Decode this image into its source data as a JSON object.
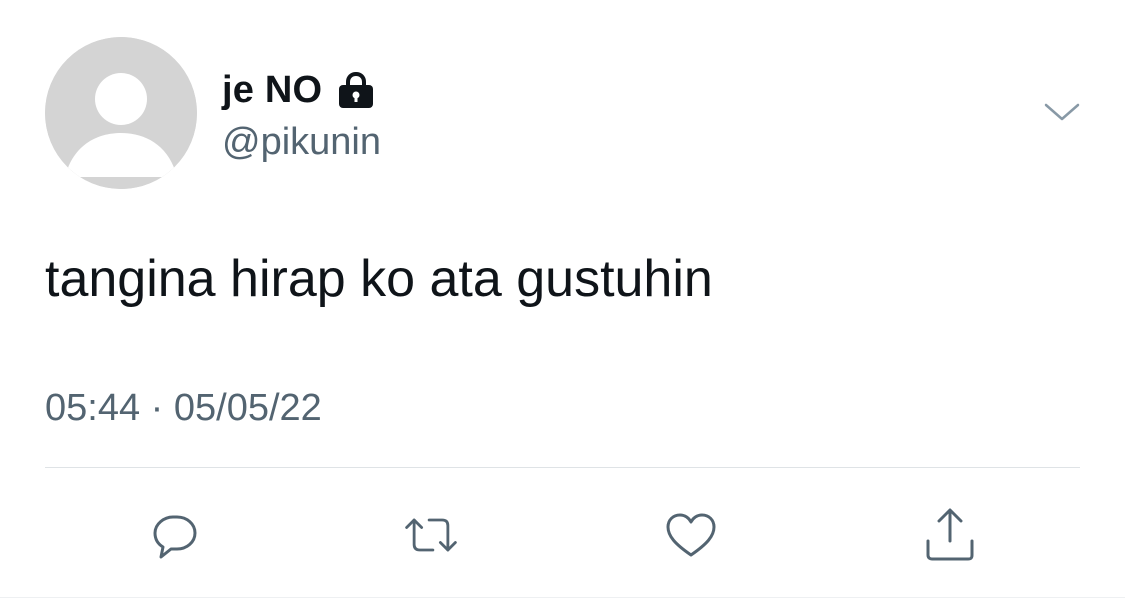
{
  "tweet": {
    "display_name": "je NO",
    "handle": "@pikunin",
    "text": "tangina hirap ko ata gustuhin",
    "timestamp": "05:44 · 05/05/22",
    "protected": true
  },
  "icons": {
    "avatar": "default-avatar-icon",
    "lock": "lock-icon",
    "menu": "chevron-down-icon",
    "reply": "reply-icon",
    "retweet": "retweet-icon",
    "like": "heart-icon",
    "share": "share-icon"
  },
  "colors": {
    "primary_text": "#0f1419",
    "secondary_text": "#536471",
    "avatar_bg": "#d4d4d4",
    "divider": "#dfe3e6"
  }
}
